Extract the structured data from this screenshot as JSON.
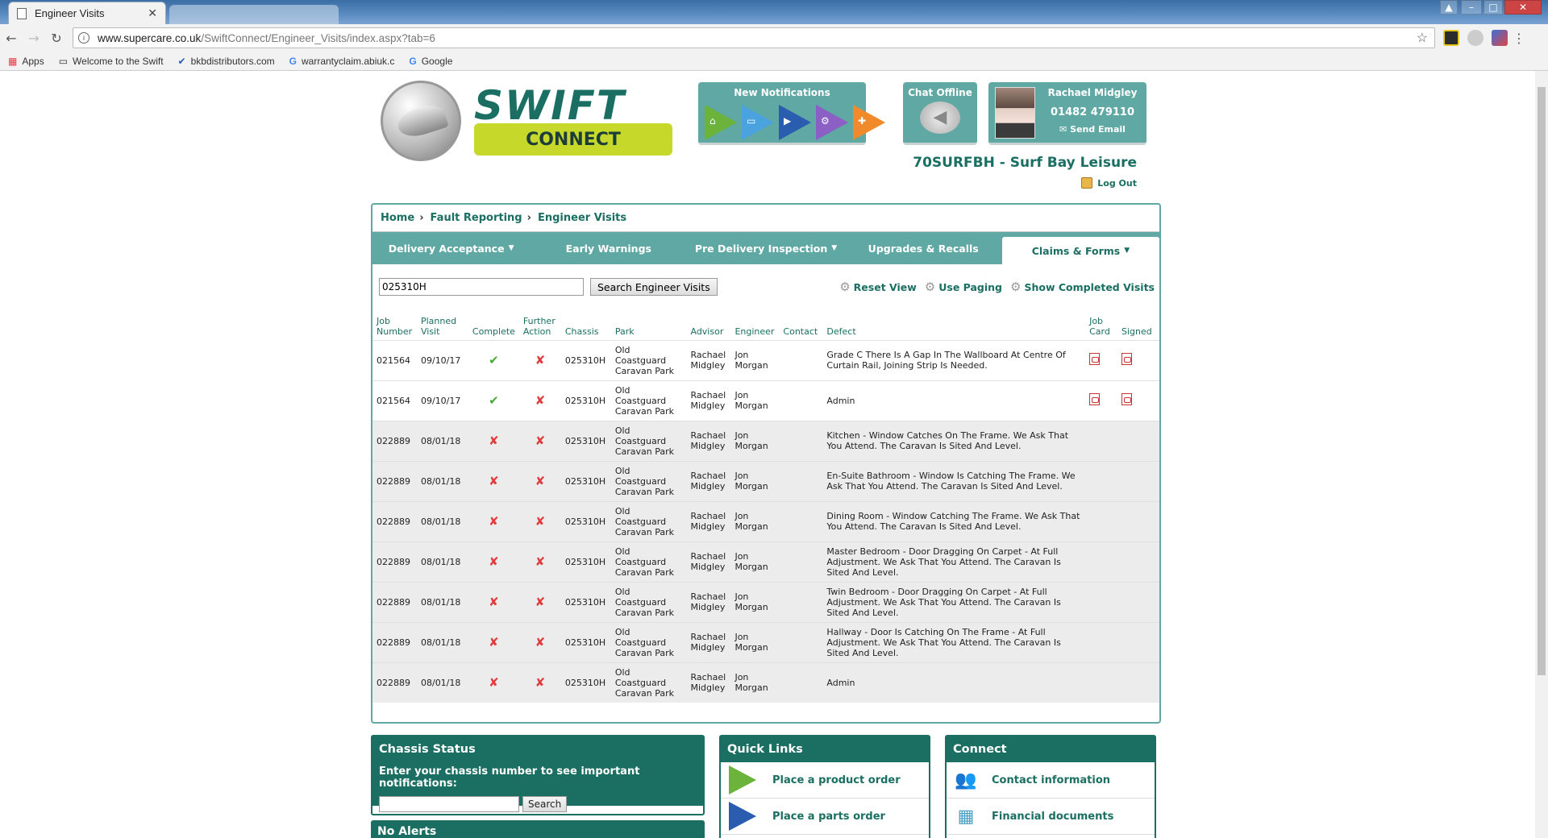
{
  "browser": {
    "tab_title": "Engineer Visits",
    "url_host": "www.supercare.co.uk",
    "url_path": "/SwiftConnect/Engineer_Visits/index.aspx?tab=6",
    "bookmarks": [
      "Apps",
      "Welcome to the Swift",
      "bkbdistributors.com",
      "warrantyclaim.abiuk.c",
      "Google"
    ]
  },
  "header": {
    "logo_word": "SWIFT",
    "logo_sub": "CONNECT",
    "notifications_title": "New Notifications",
    "chat_title": "Chat Offline",
    "user_name": "Rachael Midgley",
    "user_phone": "01482 479110",
    "user_email_label": "Send Email",
    "dealer": "70SURFBH - Surf Bay Leisure",
    "logout_label": "Log Out"
  },
  "breadcrumb": [
    "Home",
    "Fault Reporting",
    "Engineer Visits"
  ],
  "nav": [
    {
      "label": "Delivery Acceptance",
      "caret": "▼"
    },
    {
      "label": "Early Warnings",
      "caret": ""
    },
    {
      "label": "Pre Delivery Inspection",
      "caret": "▼"
    },
    {
      "label": "Upgrades & Recalls",
      "caret": ""
    },
    {
      "label": "Claims & Forms",
      "caret": "▼"
    }
  ],
  "search": {
    "value": "025310H",
    "button_label": "Search Engineer Visits"
  },
  "tool_links": [
    "Reset View",
    "Use Paging",
    "Show Completed Visits"
  ],
  "table": {
    "headers": [
      "Job Number",
      "Planned Visit",
      "Complete",
      "Further Action",
      "Chassis",
      "Park",
      "Advisor",
      "Engineer",
      "Contact",
      "Defect",
      "Job Card",
      "Signed"
    ],
    "rows": [
      {
        "job": "021564",
        "date": "09/10/17",
        "complete": true,
        "further": false,
        "chassis": "025310H",
        "park": "Old Coastguard Caravan Park",
        "advisor": "Rachael Midgley",
        "engineer": "Jon Morgan",
        "contact": "",
        "defect": "Grade C There Is A Gap In The Wallboard At Centre Of Curtain Rail, Joining Strip Is Needed.",
        "jobcard": true,
        "signed": true
      },
      {
        "job": "021564",
        "date": "09/10/17",
        "complete": true,
        "further": false,
        "chassis": "025310H",
        "park": "Old Coastguard Caravan Park",
        "advisor": "Rachael Midgley",
        "engineer": "Jon Morgan",
        "contact": "",
        "defect": "Admin",
        "jobcard": true,
        "signed": true
      },
      {
        "job": "022889",
        "date": "08/01/18",
        "complete": false,
        "further": false,
        "chassis": "025310H",
        "park": "Old Coastguard Caravan Park",
        "advisor": "Rachael Midgley",
        "engineer": "Jon Morgan",
        "contact": "",
        "defect": "Kitchen - Window Catches On The Frame. We Ask That You Attend. The Caravan Is Sited And Level.",
        "jobcard": false,
        "signed": false
      },
      {
        "job": "022889",
        "date": "08/01/18",
        "complete": false,
        "further": false,
        "chassis": "025310H",
        "park": "Old Coastguard Caravan Park",
        "advisor": "Rachael Midgley",
        "engineer": "Jon Morgan",
        "contact": "",
        "defect": "En-Suite Bathroom - Window Is Catching The Frame. We Ask That You Attend. The Caravan Is Sited And Level.",
        "jobcard": false,
        "signed": false
      },
      {
        "job": "022889",
        "date": "08/01/18",
        "complete": false,
        "further": false,
        "chassis": "025310H",
        "park": "Old Coastguard Caravan Park",
        "advisor": "Rachael Midgley",
        "engineer": "Jon Morgan",
        "contact": "",
        "defect": "Dining Room - Window Catching The Frame. We Ask That You Attend. The Caravan Is Sited And Level.",
        "jobcard": false,
        "signed": false
      },
      {
        "job": "022889",
        "date": "08/01/18",
        "complete": false,
        "further": false,
        "chassis": "025310H",
        "park": "Old Coastguard Caravan Park",
        "advisor": "Rachael Midgley",
        "engineer": "Jon Morgan",
        "contact": "",
        "defect": "Master Bedroom - Door Dragging On Carpet - At Full Adjustment. We Ask That You Attend. The Caravan Is Sited And Level.",
        "jobcard": false,
        "signed": false
      },
      {
        "job": "022889",
        "date": "08/01/18",
        "complete": false,
        "further": false,
        "chassis": "025310H",
        "park": "Old Coastguard Caravan Park",
        "advisor": "Rachael Midgley",
        "engineer": "Jon Morgan",
        "contact": "",
        "defect": "Twin Bedroom - Door Dragging On Carpet - At Full Adjustment. We Ask That You Attend. The Caravan Is Sited And Level.",
        "jobcard": false,
        "signed": false
      },
      {
        "job": "022889",
        "date": "08/01/18",
        "complete": false,
        "further": false,
        "chassis": "025310H",
        "park": "Old Coastguard Caravan Park",
        "advisor": "Rachael Midgley",
        "engineer": "Jon Morgan",
        "contact": "",
        "defect": "Hallway - Door Is Catching On The Frame - At Full Adjustment. We Ask That You Attend. The Caravan Is Sited And Level.",
        "jobcard": false,
        "signed": false
      },
      {
        "job": "022889",
        "date": "08/01/18",
        "complete": false,
        "further": false,
        "chassis": "025310H",
        "park": "Old Coastguard Caravan Park",
        "advisor": "Rachael Midgley",
        "engineer": "Jon Morgan",
        "contact": "",
        "defect": "Admin",
        "jobcard": false,
        "signed": false
      }
    ]
  },
  "chassis_status": {
    "title": "Chassis Status",
    "prompt": "Enter your chassis number to see important notifications:",
    "input_value": "",
    "button_label": "Search"
  },
  "quick_links": {
    "title": "Quick Links",
    "items": [
      "Place a product order",
      "Place a parts order"
    ]
  },
  "connect": {
    "title": "Connect",
    "items": [
      "Contact information",
      "Financial documents"
    ]
  },
  "alerts_title": "No Alerts",
  "colors": {
    "brand_dark": "#1a6e62",
    "brand_mid": "#5fa8a4",
    "lime": "#c6d92a",
    "tick": "#4aa83a",
    "cross": "#e23b3b"
  }
}
